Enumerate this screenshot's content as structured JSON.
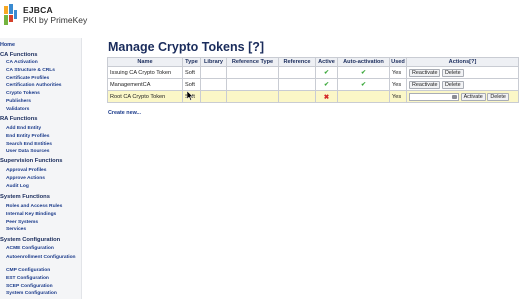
{
  "logo": {
    "title": "EJBCA",
    "subtitle": "PKI by PrimeKey",
    "colors": [
      "#f7a823",
      "#3a8bd1",
      "#74b43f",
      "#d5402a"
    ]
  },
  "sidebar": {
    "home": "Home",
    "sections": [
      {
        "title": "CA Functions",
        "items": [
          "CA Activation",
          "CA Structure & CRLs",
          "Certificate Profiles",
          "Certification Authorities",
          "Crypto Tokens",
          "Publishers",
          "Validators"
        ]
      },
      {
        "title": "RA Functions",
        "items": [
          "Add End Entity",
          "End Entity Profiles",
          "Search End Entities",
          "User Data Sources"
        ]
      },
      {
        "title": "Supervision Functions",
        "items": [
          "Approval Profiles",
          "Approve Actions",
          "Audit Log"
        ]
      },
      {
        "title": "System Functions",
        "items": [
          "Roles and Access Rules",
          "Internal Key Bindings",
          "Peer Systems",
          "Services"
        ]
      },
      {
        "title": "System Configuration",
        "items": [
          "ACME Configuration",
          "Autoenrollment Configuration",
          "CMP Configuration",
          "EST Configuration",
          "SCEP Configuration",
          "System Configuration"
        ]
      }
    ]
  },
  "main": {
    "title": "Manage Crypto Tokens [?]",
    "columns": [
      "Name",
      "Type",
      "Library",
      "Reference Type",
      "Reference",
      "Active",
      "Auto-activation",
      "Used",
      "Actions[?]"
    ],
    "rows": [
      {
        "name": "Issuing CA Crypto Token",
        "type": "Soft",
        "library": "",
        "reference_type": "",
        "reference": "",
        "active": true,
        "auto_activation": true,
        "used": "Yes",
        "actions": [
          "Reactivate",
          "Delete"
        ]
      },
      {
        "name": "ManagementCA",
        "type": "Soft",
        "library": "",
        "reference_type": "",
        "reference": "",
        "active": true,
        "auto_activation": true,
        "used": "Yes",
        "actions": [
          "Reactivate",
          "Delete"
        ]
      },
      {
        "name": "Root CA Crypto Token",
        "type": "Soft",
        "library": "",
        "reference_type": "",
        "reference": "",
        "active": false,
        "auto_activation": false,
        "used": "Yes",
        "actions": [
          "Activate",
          "Delete"
        ]
      }
    ],
    "create_link": "Create new..."
  }
}
